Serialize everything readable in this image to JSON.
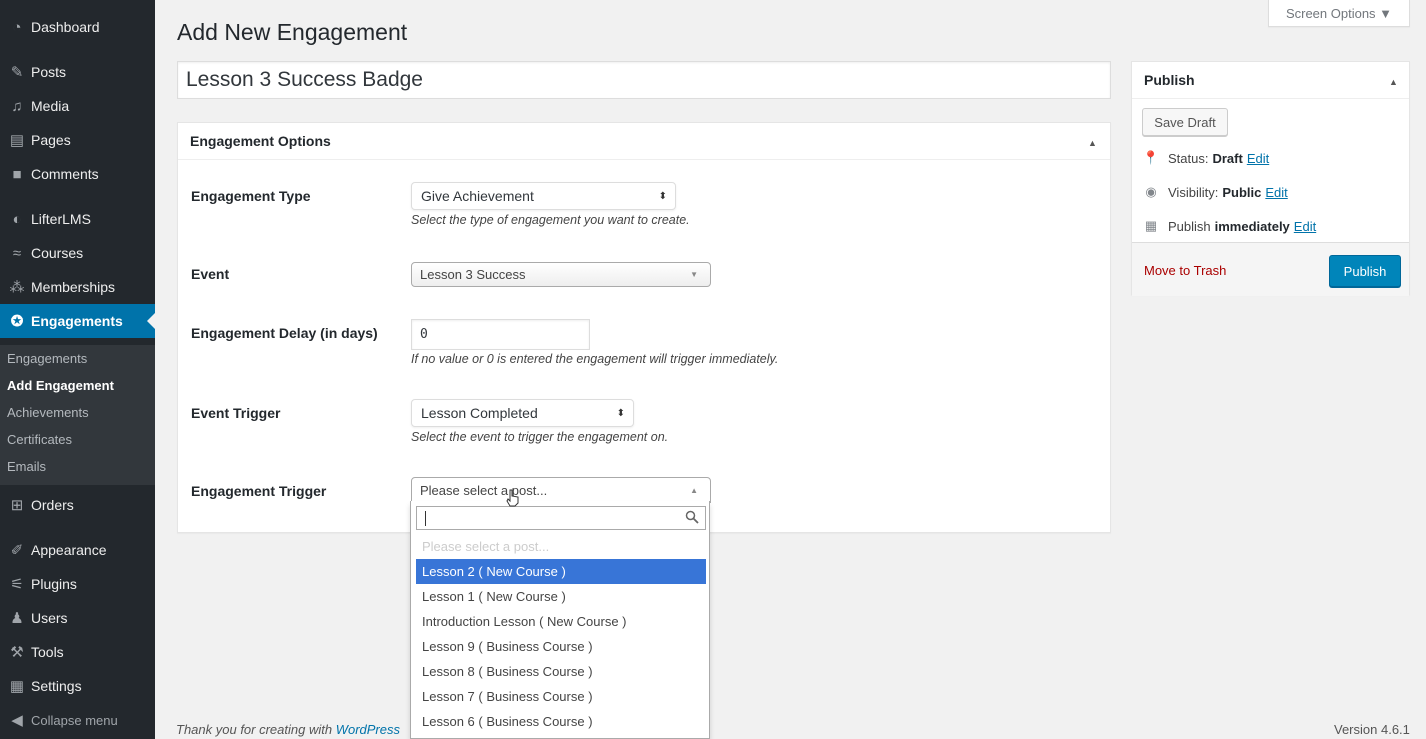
{
  "sidebar": {
    "items": [
      {
        "label": "Dashboard",
        "icon": "dashboard-icon"
      },
      {
        "label": "Posts",
        "icon": "pin-icon"
      },
      {
        "label": "Media",
        "icon": "media-icon"
      },
      {
        "label": "Pages",
        "icon": "pages-icon"
      },
      {
        "label": "Comments",
        "icon": "comment-icon"
      },
      {
        "label": "LifterLMS",
        "icon": "lifterlms-icon"
      },
      {
        "label": "Courses",
        "icon": "graduation-cap-icon"
      },
      {
        "label": "Memberships",
        "icon": "groups-icon"
      },
      {
        "label": "Engagements",
        "icon": "award-icon"
      },
      {
        "label": "Orders",
        "icon": "cart-icon"
      },
      {
        "label": "Appearance",
        "icon": "paintbrush-icon"
      },
      {
        "label": "Plugins",
        "icon": "plugin-icon"
      },
      {
        "label": "Users",
        "icon": "users-icon"
      },
      {
        "label": "Tools",
        "icon": "wrench-icon"
      },
      {
        "label": "Settings",
        "icon": "settings-icon"
      }
    ],
    "submenu": [
      "Engagements",
      "Add Engagement",
      "Achievements",
      "Certificates",
      "Emails"
    ],
    "collapse_label": "Collapse menu"
  },
  "header": {
    "title": "Add New Engagement",
    "screen_options": "Screen Options ▼"
  },
  "post_title": "Lesson 3 Success Badge",
  "engagement_options": {
    "heading": "Engagement Options",
    "type_label": "Engagement Type",
    "type_value": "Give Achievement",
    "type_help": "Select the type of engagement you want to create.",
    "event_label": "Event",
    "event_value": "Lesson 3 Success",
    "delay_label": "Engagement Delay (in days)",
    "delay_value": "0",
    "delay_help": "If no value or 0 is entered the engagement will trigger immediately.",
    "trigger_label": "Event Trigger",
    "trigger_value": "Lesson Completed",
    "trigger_help": "Select the event to trigger the engagement on.",
    "eng_trigger_label": "Engagement Trigger",
    "eng_trigger_value": "Please select a post..."
  },
  "dropdown": {
    "placeholder": "Please select a post...",
    "options": [
      "Lesson 2 ( New Course )",
      "Lesson 1 ( New Course )",
      "Introduction Lesson ( New Course )",
      "Lesson 9 ( Business Course )",
      "Lesson 8 ( Business Course )",
      "Lesson 7 ( Business Course )",
      "Lesson 6 ( Business Course )"
    ],
    "highlighted": "Lesson 2 ( New Course )"
  },
  "publish": {
    "heading": "Publish",
    "save_draft": "Save Draft",
    "status_label": "Status:",
    "status_value": "Draft",
    "visibility_label": "Visibility:",
    "visibility_value": "Public",
    "publish_label": "Publish",
    "publish_value": "immediately",
    "edit_link": "Edit",
    "move_to_trash": "Move to Trash",
    "publish_button": "Publish"
  },
  "footer": {
    "thanks_prefix": "Thank you for creating with",
    "thanks_link": "WordPress",
    "version": "Version 4.6.1"
  },
  "colors": {
    "sidebar_bg": "#23282d",
    "active_menu": "#0073aa",
    "highlight": "#3875d7",
    "publish_button": "#0085ba",
    "trash_link": "#a00"
  }
}
